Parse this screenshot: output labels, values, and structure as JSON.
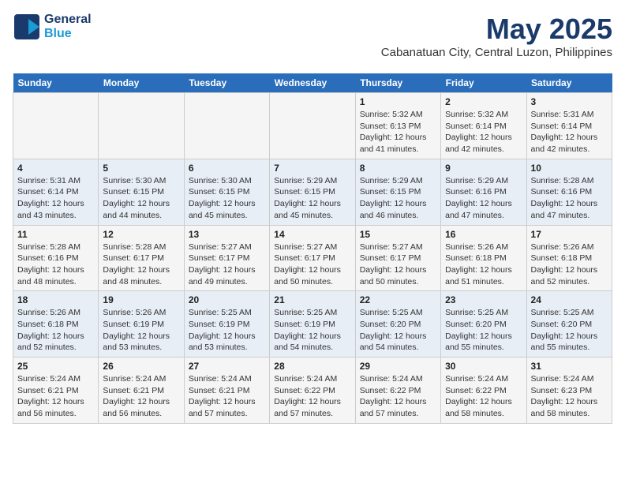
{
  "logo": {
    "line1": "General",
    "line2": "Blue"
  },
  "title": "May 2025",
  "subtitle": "Cabanatuan City, Central Luzon, Philippines",
  "days_of_week": [
    "Sunday",
    "Monday",
    "Tuesday",
    "Wednesday",
    "Thursday",
    "Friday",
    "Saturday"
  ],
  "weeks": [
    [
      {
        "day": "",
        "info": ""
      },
      {
        "day": "",
        "info": ""
      },
      {
        "day": "",
        "info": ""
      },
      {
        "day": "",
        "info": ""
      },
      {
        "day": "1",
        "info": "Sunrise: 5:32 AM\nSunset: 6:13 PM\nDaylight: 12 hours\nand 41 minutes."
      },
      {
        "day": "2",
        "info": "Sunrise: 5:32 AM\nSunset: 6:14 PM\nDaylight: 12 hours\nand 42 minutes."
      },
      {
        "day": "3",
        "info": "Sunrise: 5:31 AM\nSunset: 6:14 PM\nDaylight: 12 hours\nand 42 minutes."
      }
    ],
    [
      {
        "day": "4",
        "info": "Sunrise: 5:31 AM\nSunset: 6:14 PM\nDaylight: 12 hours\nand 43 minutes."
      },
      {
        "day": "5",
        "info": "Sunrise: 5:30 AM\nSunset: 6:15 PM\nDaylight: 12 hours\nand 44 minutes."
      },
      {
        "day": "6",
        "info": "Sunrise: 5:30 AM\nSunset: 6:15 PM\nDaylight: 12 hours\nand 45 minutes."
      },
      {
        "day": "7",
        "info": "Sunrise: 5:29 AM\nSunset: 6:15 PM\nDaylight: 12 hours\nand 45 minutes."
      },
      {
        "day": "8",
        "info": "Sunrise: 5:29 AM\nSunset: 6:15 PM\nDaylight: 12 hours\nand 46 minutes."
      },
      {
        "day": "9",
        "info": "Sunrise: 5:29 AM\nSunset: 6:16 PM\nDaylight: 12 hours\nand 47 minutes."
      },
      {
        "day": "10",
        "info": "Sunrise: 5:28 AM\nSunset: 6:16 PM\nDaylight: 12 hours\nand 47 minutes."
      }
    ],
    [
      {
        "day": "11",
        "info": "Sunrise: 5:28 AM\nSunset: 6:16 PM\nDaylight: 12 hours\nand 48 minutes."
      },
      {
        "day": "12",
        "info": "Sunrise: 5:28 AM\nSunset: 6:17 PM\nDaylight: 12 hours\nand 48 minutes."
      },
      {
        "day": "13",
        "info": "Sunrise: 5:27 AM\nSunset: 6:17 PM\nDaylight: 12 hours\nand 49 minutes."
      },
      {
        "day": "14",
        "info": "Sunrise: 5:27 AM\nSunset: 6:17 PM\nDaylight: 12 hours\nand 50 minutes."
      },
      {
        "day": "15",
        "info": "Sunrise: 5:27 AM\nSunset: 6:17 PM\nDaylight: 12 hours\nand 50 minutes."
      },
      {
        "day": "16",
        "info": "Sunrise: 5:26 AM\nSunset: 6:18 PM\nDaylight: 12 hours\nand 51 minutes."
      },
      {
        "day": "17",
        "info": "Sunrise: 5:26 AM\nSunset: 6:18 PM\nDaylight: 12 hours\nand 52 minutes."
      }
    ],
    [
      {
        "day": "18",
        "info": "Sunrise: 5:26 AM\nSunset: 6:18 PM\nDaylight: 12 hours\nand 52 minutes."
      },
      {
        "day": "19",
        "info": "Sunrise: 5:26 AM\nSunset: 6:19 PM\nDaylight: 12 hours\nand 53 minutes."
      },
      {
        "day": "20",
        "info": "Sunrise: 5:25 AM\nSunset: 6:19 PM\nDaylight: 12 hours\nand 53 minutes."
      },
      {
        "day": "21",
        "info": "Sunrise: 5:25 AM\nSunset: 6:19 PM\nDaylight: 12 hours\nand 54 minutes."
      },
      {
        "day": "22",
        "info": "Sunrise: 5:25 AM\nSunset: 6:20 PM\nDaylight: 12 hours\nand 54 minutes."
      },
      {
        "day": "23",
        "info": "Sunrise: 5:25 AM\nSunset: 6:20 PM\nDaylight: 12 hours\nand 55 minutes."
      },
      {
        "day": "24",
        "info": "Sunrise: 5:25 AM\nSunset: 6:20 PM\nDaylight: 12 hours\nand 55 minutes."
      }
    ],
    [
      {
        "day": "25",
        "info": "Sunrise: 5:24 AM\nSunset: 6:21 PM\nDaylight: 12 hours\nand 56 minutes."
      },
      {
        "day": "26",
        "info": "Sunrise: 5:24 AM\nSunset: 6:21 PM\nDaylight: 12 hours\nand 56 minutes."
      },
      {
        "day": "27",
        "info": "Sunrise: 5:24 AM\nSunset: 6:21 PM\nDaylight: 12 hours\nand 57 minutes."
      },
      {
        "day": "28",
        "info": "Sunrise: 5:24 AM\nSunset: 6:22 PM\nDaylight: 12 hours\nand 57 minutes."
      },
      {
        "day": "29",
        "info": "Sunrise: 5:24 AM\nSunset: 6:22 PM\nDaylight: 12 hours\nand 57 minutes."
      },
      {
        "day": "30",
        "info": "Sunrise: 5:24 AM\nSunset: 6:22 PM\nDaylight: 12 hours\nand 58 minutes."
      },
      {
        "day": "31",
        "info": "Sunrise: 5:24 AM\nSunset: 6:23 PM\nDaylight: 12 hours\nand 58 minutes."
      }
    ]
  ]
}
